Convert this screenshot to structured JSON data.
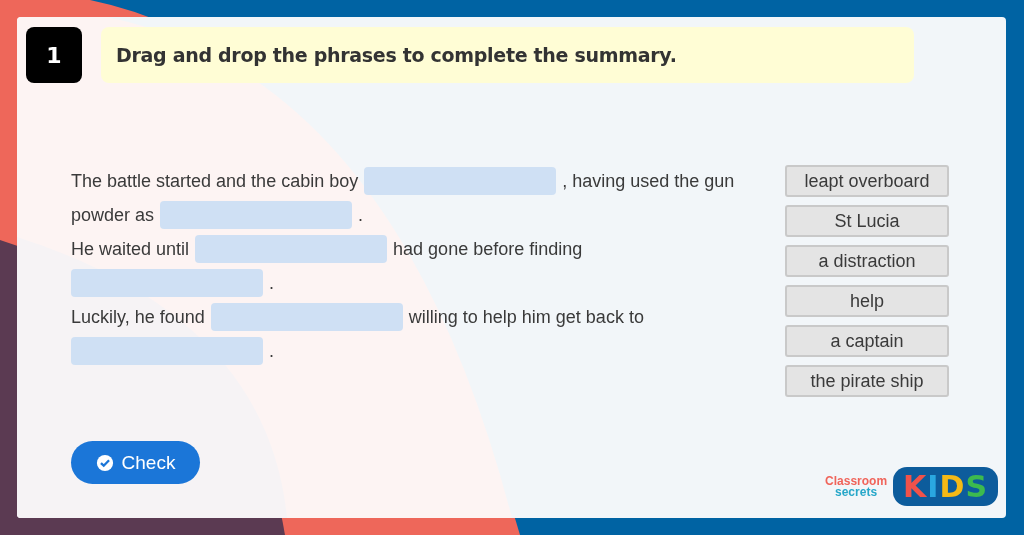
{
  "question": {
    "number": "1",
    "instruction": "Drag and drop the phrases to complete the summary."
  },
  "summary_lines": [
    [
      {
        "kind": "text",
        "text": "The battle started and the cabin boy"
      },
      {
        "kind": "blank"
      },
      {
        "kind": "text",
        "text": ", having used the gun"
      }
    ],
    [
      {
        "kind": "text",
        "text": "powder as"
      },
      {
        "kind": "blank"
      },
      {
        "kind": "text",
        "text": "."
      }
    ],
    [
      {
        "kind": "text",
        "text": "He waited until"
      },
      {
        "kind": "blank"
      },
      {
        "kind": "text",
        "text": "had gone before finding"
      }
    ],
    [
      {
        "kind": "blank"
      },
      {
        "kind": "text",
        "text": "."
      }
    ],
    [
      {
        "kind": "text",
        "text": "Luckily, he found"
      },
      {
        "kind": "blank"
      },
      {
        "kind": "text",
        "text": "willing to help him get back to"
      }
    ],
    [
      {
        "kind": "blank"
      },
      {
        "kind": "text",
        "text": "."
      }
    ]
  ],
  "phrases": [
    "leapt overboard",
    "St Lucia",
    "a distraction",
    "help",
    "a captain",
    "the pirate ship"
  ],
  "check_button": {
    "label": "Check"
  },
  "logo": {
    "brand_top": "Classroom",
    "brand_bottom": "secrets",
    "badge": "KIDS"
  }
}
